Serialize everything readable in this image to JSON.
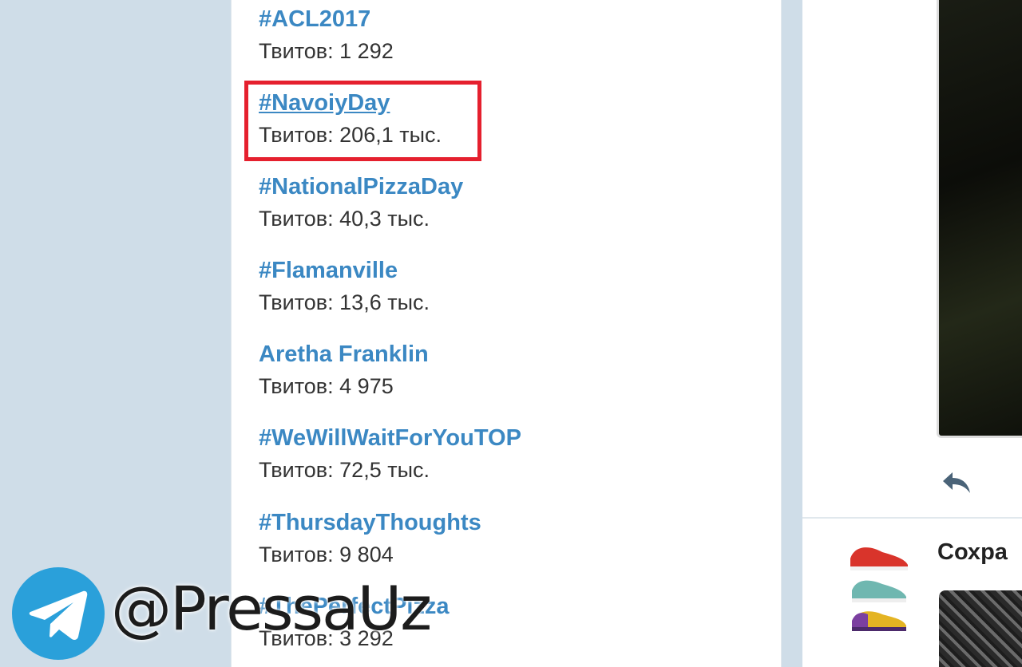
{
  "trends": [
    {
      "name": "#ACL2017",
      "count": "Твитов: 1 292"
    },
    {
      "name": "#NavoiyDay",
      "count": "Твитов: 206,1 тыс.",
      "highlighted": true
    },
    {
      "name": "#NationalPizzaDay",
      "count": "Твитов: 40,3 тыс."
    },
    {
      "name": "#Flamanville",
      "count": "Твитов: 13,6 тыс."
    },
    {
      "name": "Aretha Franklin",
      "count": "Твитов: 4 975"
    },
    {
      "name": "#WeWillWaitForYouTOP",
      "count": "Твитов: 72,5 тыс."
    },
    {
      "name": "#ThursdayThoughts",
      "count": "Твитов: 9 804"
    },
    {
      "name": "#ThePerfectPizza",
      "count": "Твитов: 3 292"
    }
  ],
  "right_panel": {
    "ad_title": "Сохра",
    "reply_icon": "reply-icon",
    "accent_color": "#3b88c3",
    "highlight_color": "#e5202e"
  },
  "watermark": {
    "text": "@PressaUz",
    "icon": "telegram-icon"
  }
}
